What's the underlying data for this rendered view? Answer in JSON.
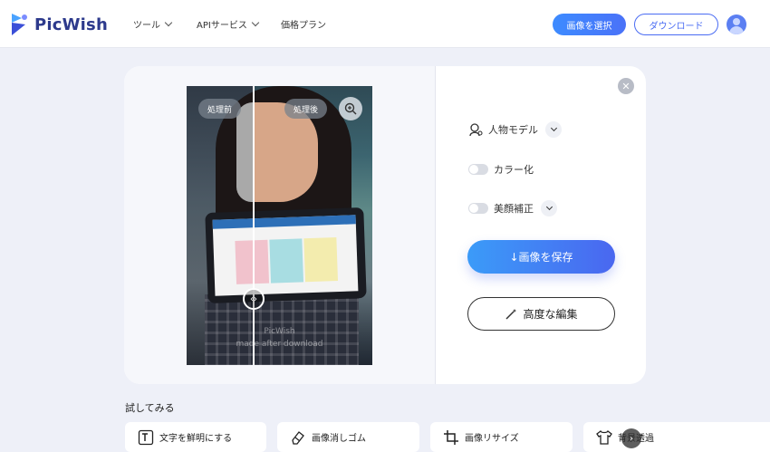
{
  "header": {
    "logo_text": "PicWish",
    "nav": [
      {
        "label": "ツール"
      },
      {
        "label": "APIサービス"
      },
      {
        "label": "価格プラン"
      }
    ],
    "select_button": "画像を選択",
    "download_button": "ダウンロード"
  },
  "preview": {
    "before_label": "処理前",
    "after_label": "処理後",
    "watermark_line1": "PicWish",
    "watermark_line2": "made after download"
  },
  "options": {
    "model_label": "人物モデル",
    "colorize_label": "カラー化",
    "colorize_on": false,
    "beauty_label": "美顔補正",
    "beauty_on": false
  },
  "actions": {
    "save_label": "↓画像を保存",
    "edit_label": "高度な編集"
  },
  "try": {
    "title": "試してみる",
    "tools": [
      {
        "label": "文字を鮮明にする",
        "icon": "text-enhance-icon"
      },
      {
        "label": "画像消しゴム",
        "icon": "eraser-icon"
      },
      {
        "label": "画像リサイズ",
        "icon": "crop-icon"
      },
      {
        "label": "背景透過",
        "icon": "shirt-icon"
      }
    ]
  },
  "colors": {
    "primary": "#4a6cf3",
    "logo": "#2d3a8c",
    "background": "#eef0f8"
  }
}
